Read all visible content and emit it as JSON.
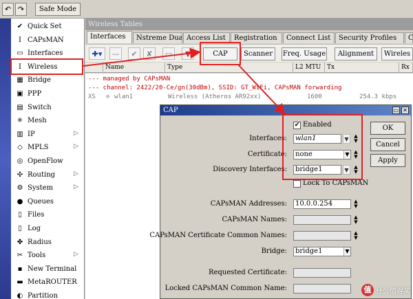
{
  "toolbar": {
    "undo_icon": "↶",
    "redo_icon": "↷",
    "safe_mode_label": "Safe Mode"
  },
  "sidebar": {
    "items": [
      {
        "label": "Quick Set",
        "icon": "quick-set-icon",
        "glyph": "✔",
        "has_submenu": false
      },
      {
        "label": "CAPsMAN",
        "icon": "capsman-icon",
        "glyph": "Ⅰ",
        "has_submenu": false
      },
      {
        "label": "Interfaces",
        "icon": "interfaces-icon",
        "glyph": "▭",
        "has_submenu": false
      },
      {
        "label": "Wireless",
        "icon": "wireless-icon",
        "glyph": "Ⅰ",
        "has_submenu": false
      },
      {
        "label": "Bridge",
        "icon": "bridge-icon",
        "glyph": "▦",
        "has_submenu": false
      },
      {
        "label": "PPP",
        "icon": "ppp-icon",
        "glyph": "▣",
        "has_submenu": false
      },
      {
        "label": "Switch",
        "icon": "switch-icon",
        "glyph": "▤",
        "has_submenu": false
      },
      {
        "label": "Mesh",
        "icon": "mesh-icon",
        "glyph": "✳",
        "has_submenu": false
      },
      {
        "label": "IP",
        "icon": "ip-icon",
        "glyph": "▥",
        "has_submenu": true
      },
      {
        "label": "MPLS",
        "icon": "mpls-icon",
        "glyph": "◇",
        "has_submenu": true
      },
      {
        "label": "OpenFlow",
        "icon": "openflow-icon",
        "glyph": "◎",
        "has_submenu": false
      },
      {
        "label": "Routing",
        "icon": "routing-icon",
        "glyph": "✣",
        "has_submenu": true
      },
      {
        "label": "System",
        "icon": "system-icon",
        "glyph": "⚙",
        "has_submenu": true
      },
      {
        "label": "Queues",
        "icon": "queues-icon",
        "glyph": "●",
        "has_submenu": false
      },
      {
        "label": "Files",
        "icon": "files-icon",
        "glyph": "▯",
        "has_submenu": false
      },
      {
        "label": "Log",
        "icon": "log-icon",
        "glyph": "▯",
        "has_submenu": false
      },
      {
        "label": "Radius",
        "icon": "radius-icon",
        "glyph": "✤",
        "has_submenu": false
      },
      {
        "label": "Tools",
        "icon": "tools-icon",
        "glyph": "✂",
        "has_submenu": true
      },
      {
        "label": "New Terminal",
        "icon": "terminal-icon",
        "glyph": "▪",
        "has_submenu": false
      },
      {
        "label": "MetaROUTER",
        "icon": "metarouter-icon",
        "glyph": "▬",
        "has_submenu": false
      },
      {
        "label": "Partition",
        "icon": "partition-icon",
        "glyph": "◐",
        "has_submenu": false
      }
    ]
  },
  "window": {
    "title": "Wireless Tables",
    "tabs": [
      "Interfaces",
      "Nstreme Dual",
      "Access List",
      "Registration",
      "Connect List",
      "Security Profiles",
      "Channe"
    ],
    "tool_icons": {
      "add": "✚▾",
      "remove": "—",
      "enable": "✔",
      "disable": "✘",
      "comment": "▭",
      "filter": "▼"
    },
    "tool_buttons": {
      "cap": "CAP",
      "scanner": "Scanner",
      "freq_usage": "Freq. Usage",
      "alignment": "Alignment",
      "wireless_sniffer": "Wireles"
    },
    "columns": [
      "Name",
      "Type",
      "L2 MTU",
      "Tx",
      "Rx"
    ],
    "rows": {
      "managed_note": "--- managed by CAPsMAN",
      "channel_note": "--- channel: 2422/20-Ce/gn(30dBm), SSID: GT_WiFi, CAPsMAN forwarding",
      "iface_flags": "XS",
      "iface_icon": "wlan-icon",
      "iface_name": "wlan1",
      "iface_type": "Wireless (Atheros AR92xx)",
      "iface_mtu": "1600",
      "iface_tx": "254.3 kbps"
    }
  },
  "dialog": {
    "title": "CAP",
    "enabled_label": "Enabled",
    "enabled_checked": true,
    "interfaces_label": "Interfaces:",
    "interfaces_value": "wlan1",
    "certificate_label": "Certificate:",
    "certificate_value": "none",
    "discovery_label": "Discovery Interfaces:",
    "discovery_value": "bridge1",
    "lock_label": "Lock To CAPsMAN",
    "lock_checked": false,
    "capsman_addresses_label": "CAPsMAN Addresses:",
    "capsman_addresses_value": "10.0.0.254",
    "capsman_names_label": "CAPsMAN Names:",
    "capsman_names_value": "",
    "cert_common_names_label": "CAPsMAN Certificate Common Names:",
    "cert_common_names_value": "",
    "bridge_label": "Bridge:",
    "bridge_value": "bridge1",
    "requested_cert_label": "Requested Certificate:",
    "requested_cert_value": "",
    "locked_common_name_label": "Locked CAPsMAN Common Name:",
    "locked_common_name_value": "",
    "ok_label": "OK",
    "cancel_label": "Cancel",
    "apply_label": "Apply",
    "minimize_glyph": "▭",
    "close_glyph": "✕"
  },
  "watermark": {
    "logo_glyph": "值",
    "text": "什么值得买"
  },
  "colors": {
    "annotation_red": "#e02020",
    "dialog_title_blue": "#1e3c8c",
    "note_red": "#c00000"
  }
}
